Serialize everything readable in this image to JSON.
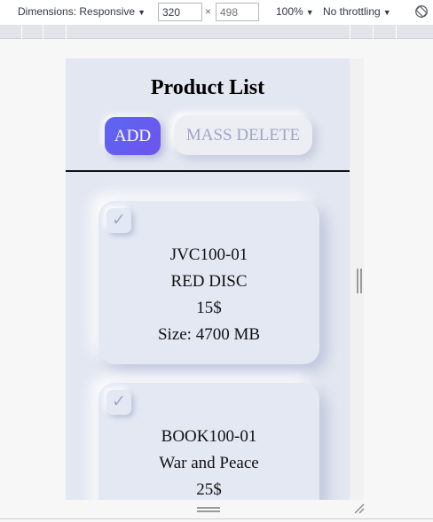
{
  "devtools": {
    "dimensions_label": "Dimensions: Responsive",
    "width_value": "320",
    "height_value": "498",
    "times": "×",
    "zoom": "100%",
    "throttling": "No throttling",
    "caret": "▼",
    "check_glyph": "✓"
  },
  "page": {
    "title": "Product List",
    "add_label": "ADD",
    "mass_delete_label": "MASS DELETE"
  },
  "products": [
    {
      "sku": "JVC100-01",
      "name": "RED DISC",
      "price": "15$",
      "attribute": "Size: 4700 MB"
    },
    {
      "sku": "BOOK100-01",
      "name": "War and Peace",
      "price": "25$",
      "attribute": ""
    }
  ]
}
